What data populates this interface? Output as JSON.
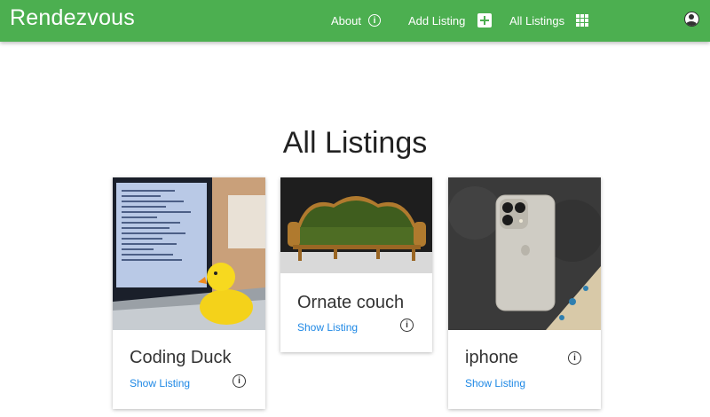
{
  "app": {
    "brand": "Rendezvous"
  },
  "nav": {
    "about_label": "About",
    "add_listing_label": "Add Listing",
    "all_listings_label": "All Listings",
    "info_glyph": "i"
  },
  "page": {
    "title": "All Listings"
  },
  "listings": [
    {
      "name": "Coding Duck",
      "link_label": "Show Listing",
      "image": "laptop-with-rubber-duck"
    },
    {
      "name": "Ornate couch",
      "link_label": "Show Listing",
      "image": "green-ornate-sofa"
    },
    {
      "name": "iphone",
      "link_label": "Show Listing",
      "image": "silver-iphone-on-dark-surface"
    }
  ],
  "colors": {
    "accent": "#4caf50",
    "link": "#1e88e5"
  }
}
